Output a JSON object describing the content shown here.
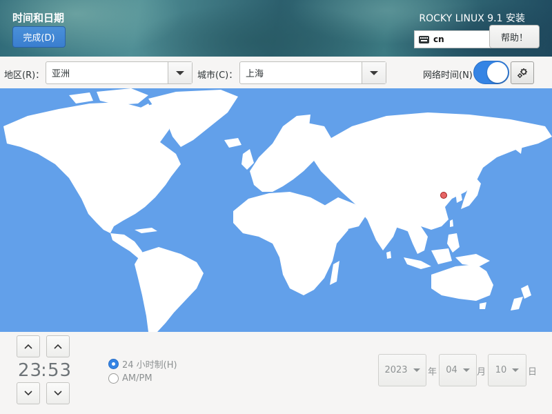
{
  "header": {
    "page_title": "时间和日期",
    "done_label": "完成(D)",
    "product_title": "ROCKY LINUX 9.1 安装",
    "keyboard_layout": "cn",
    "help_label": "帮助！",
    "icons": {
      "keyboard": "keyboard-icon"
    }
  },
  "selectors": {
    "region_label": "地区(R)：",
    "region_value": "亚洲",
    "city_label": "城市(C)：",
    "city_value": "上海",
    "network_time_label": "网络时间(N)",
    "network_time_enabled": true,
    "icons": {
      "dropdown": "chevron-down-icon",
      "settings": "gear-icon"
    }
  },
  "map": {
    "selected_city": "上海",
    "marker_color": "#e66565",
    "ocean_color": "#62a0ea",
    "land_color": "#ffffff"
  },
  "time": {
    "hours": "23",
    "separator": ":",
    "minutes": "53",
    "icons": {
      "up": "chevron-up-icon",
      "down": "chevron-down-icon"
    }
  },
  "time_format": {
    "option_24h": "24 小时制(H)",
    "option_ampm": "AM/PM",
    "selected": "24h"
  },
  "date": {
    "year": "2023",
    "year_suffix": "年",
    "month": "04",
    "month_suffix": "月",
    "day": "10",
    "day_suffix": "日"
  },
  "colors": {
    "accent": "#3584e4",
    "text": "#2e3436",
    "disabled_text": "#8d9192"
  }
}
